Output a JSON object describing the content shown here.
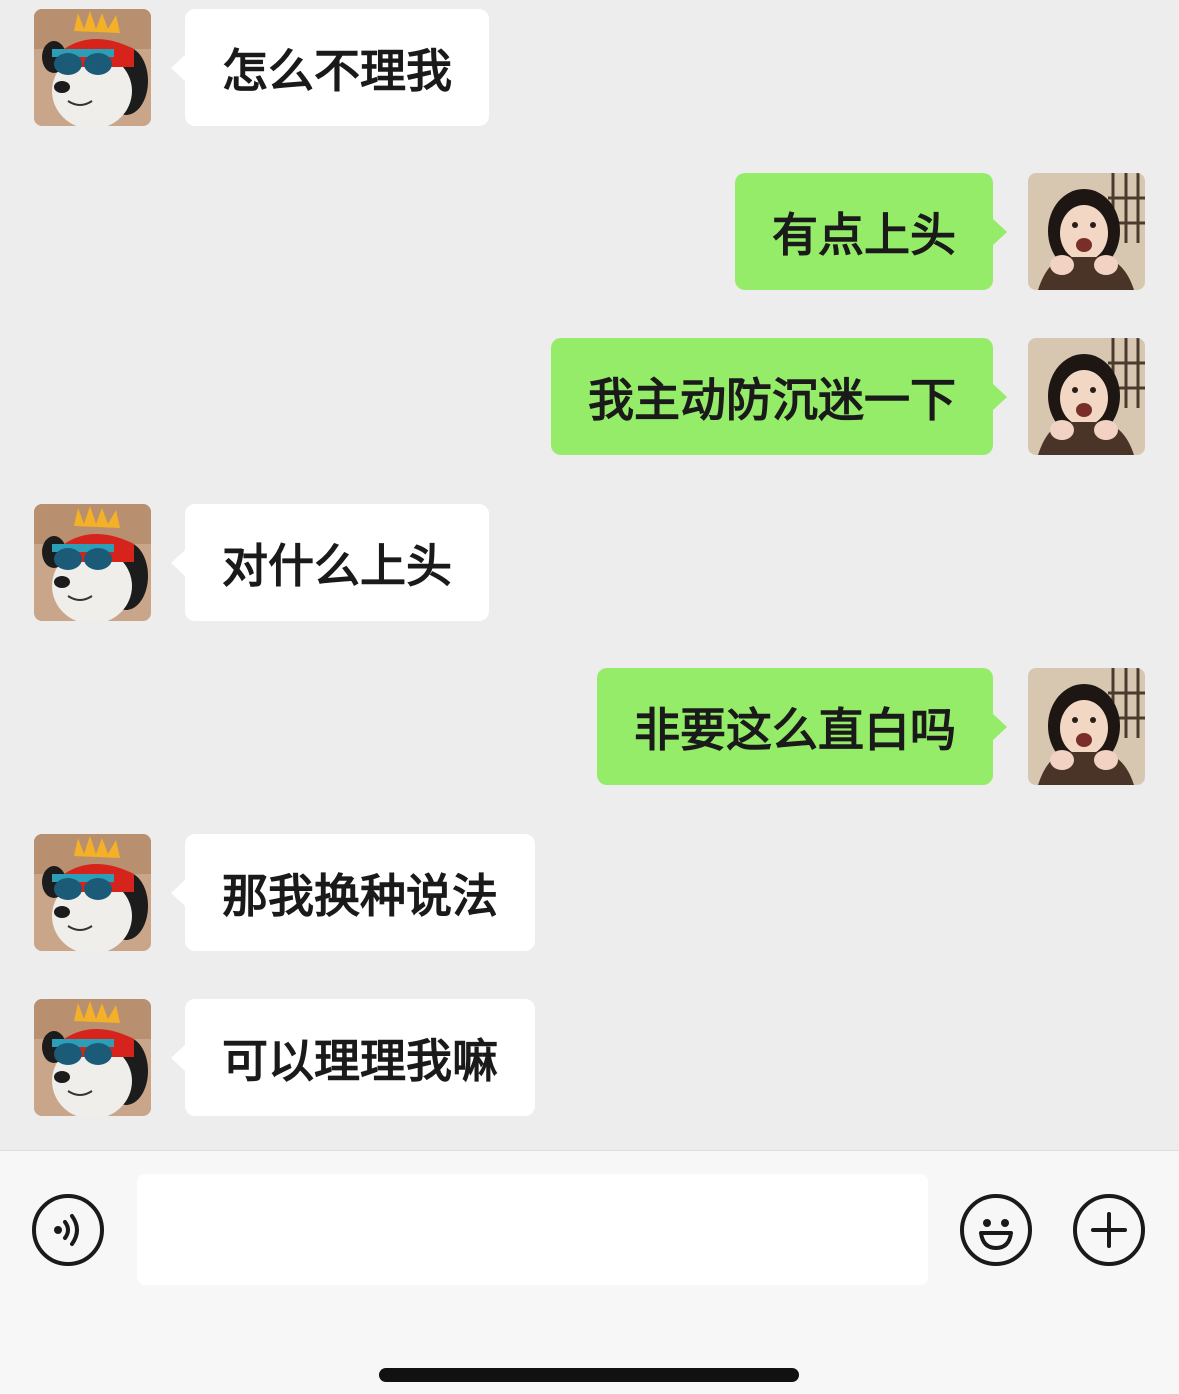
{
  "messages": [
    {
      "side": "left",
      "text": "怎么不理我"
    },
    {
      "side": "right",
      "text": "有点上头"
    },
    {
      "side": "right",
      "text": "我主动防沉迷一下"
    },
    {
      "side": "left",
      "text": "对什么上头"
    },
    {
      "side": "right",
      "text": "非要这么直白吗"
    },
    {
      "side": "left",
      "text": "那我换种说法"
    },
    {
      "side": "left",
      "text": "可以理理我嘛"
    }
  ],
  "input": {
    "value": "",
    "placeholder": ""
  },
  "icons": {
    "voice": "voice-icon",
    "emoji": "emoji-icon",
    "plus": "plus-icon"
  },
  "colors": {
    "background": "#ededed",
    "sent_bubble": "#95ec69",
    "received_bubble": "#ffffff"
  }
}
